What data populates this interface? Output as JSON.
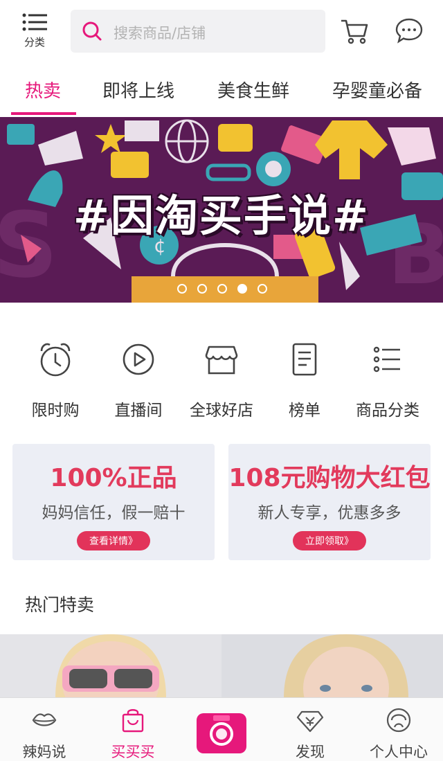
{
  "header": {
    "category_label": "分类",
    "search_placeholder": "搜索商品/店铺",
    "icons": {
      "category": "category-list-icon",
      "search": "search-icon",
      "cart": "cart-icon",
      "message": "message-icon"
    }
  },
  "tabs": [
    {
      "label": "热卖",
      "active": true
    },
    {
      "label": "即将上线",
      "active": false
    },
    {
      "label": "美食生鲜",
      "active": false
    },
    {
      "label": "孕婴童必备",
      "active": false
    }
  ],
  "banner": {
    "title": "#因淘买手说#",
    "slide_count": 5,
    "active_slide": 4
  },
  "quick_entries": [
    {
      "label": "限时购",
      "icon": "alarm-clock-icon"
    },
    {
      "label": "直播间",
      "icon": "play-icon"
    },
    {
      "label": "全球好店",
      "icon": "store-icon"
    },
    {
      "label": "榜单",
      "icon": "list-document-icon"
    },
    {
      "label": "商品分类",
      "icon": "category-list-icon"
    }
  ],
  "promos": [
    {
      "title": "100%正品",
      "subtitle": "妈妈信任，假一赔十",
      "button": "查看详情》"
    },
    {
      "title": "108元购物大红包",
      "subtitle": "新人专享，优惠多多",
      "button": "立即领取》"
    }
  ],
  "section": {
    "title": "热门特卖"
  },
  "bottom_nav": [
    {
      "label": "辣妈说",
      "icon": "lips-icon",
      "active": false
    },
    {
      "label": "买买买",
      "icon": "shopping-bag-icon",
      "active": true
    },
    {
      "label": "",
      "icon": "camera-icon",
      "active": false
    },
    {
      "label": "发现",
      "icon": "diamond-icon",
      "active": false
    },
    {
      "label": "个人中心",
      "icon": "profile-icon",
      "active": false
    }
  ],
  "colors": {
    "accent": "#e6187b",
    "promo_red": "#e23a5c",
    "banner_bg": "#5a1b55"
  }
}
